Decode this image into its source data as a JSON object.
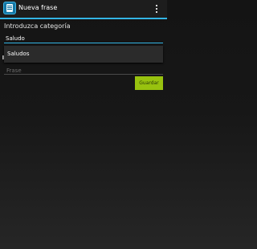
{
  "actionbar": {
    "title": "Nueva frase",
    "app_icon": "notepad-icon",
    "overflow_icon": "overflow-menu-icon"
  },
  "form": {
    "prompt": "Introduzca categoría",
    "category_value": "Saludo",
    "dropdown_option": "Saludos",
    "phrase_placeholder": "Frase",
    "save_label": "Guardar"
  },
  "colors": {
    "accent": "#33b5e5",
    "save_button": "#98c20f"
  }
}
